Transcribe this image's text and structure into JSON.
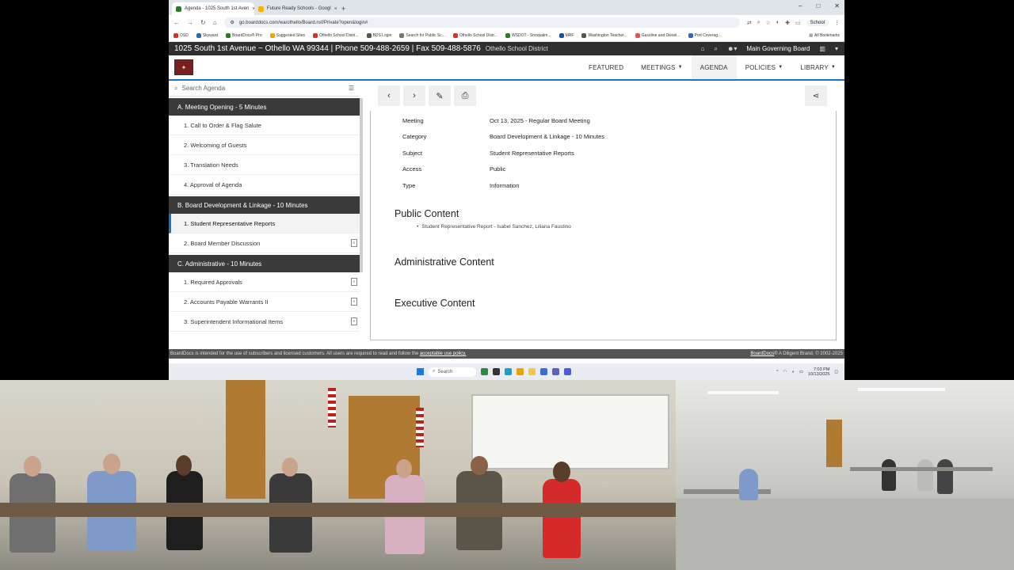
{
  "browser": {
    "tabs": [
      {
        "label": "Agenda - 1025 South 1st Aven",
        "color": "#2a7a2a",
        "active": true
      },
      {
        "label": "Future Ready Schools - Googl",
        "color": "#f4b400",
        "active": false
      }
    ],
    "url": "go.boarddocs.com/wa/othello/Board.nsf/Private?open&login#",
    "profile_label": "School",
    "bookmarks": [
      "OSD",
      "Skyward",
      "BoardDocs® Pro",
      "Suggested Sites",
      "Othello School Distri...",
      "BDS Login",
      "Search for Public Sc...",
      "Othello School Distr...",
      "WSDOT - Snoqualm...",
      "MRF",
      "Washington Teacher...",
      "Gasoline and Diesel...",
      "Port Coverag..."
    ],
    "all_bookmarks": "All Bookmarks"
  },
  "site": {
    "contact": "1025 South 1st Avenue ~ Othello WA 99344 | Phone 509-488-2659 | Fax 509-488-5876",
    "district": "Othello School District",
    "board_name": "Main Governing Board",
    "nav": [
      "FEATURED",
      "MEETINGS",
      "AGENDA",
      "POLICIES",
      "LIBRARY"
    ]
  },
  "sidebar": {
    "search_placeholder": "Search Agenda",
    "sections": [
      {
        "title": "A. Meeting Opening - 5 Minutes",
        "items": [
          {
            "label": "1. Call to Order & Flag Salute",
            "doc": false,
            "active": false
          },
          {
            "label": "2. Welcoming of Guests",
            "doc": false,
            "active": false
          },
          {
            "label": "3. Translation Needs",
            "doc": false,
            "active": false
          },
          {
            "label": "4. Approval of Agenda",
            "doc": false,
            "active": false
          }
        ]
      },
      {
        "title": "B. Board Development & Linkage - 10 Minutes",
        "items": [
          {
            "label": "1. Student Representative Reports",
            "doc": false,
            "active": true
          },
          {
            "label": "2. Board Member Discussion",
            "doc": true,
            "active": false
          }
        ]
      },
      {
        "title": "C. Administrative - 10 Minutes",
        "items": [
          {
            "label": "1. Required Approvals",
            "doc": true,
            "active": false
          },
          {
            "label": "2. Accounts Payable Warrants II",
            "doc": true,
            "active": false
          },
          {
            "label": "3. Superintendent Informational Items",
            "doc": true,
            "active": false
          }
        ]
      }
    ]
  },
  "detail": {
    "rows": [
      {
        "key": "Meeting",
        "value": "Oct 13, 2025 - Regular Board Meeting"
      },
      {
        "key": "Category",
        "value": "Board Development & Linkage - 10 Minutes"
      },
      {
        "key": "Subject",
        "value": "Student Representative Reports"
      },
      {
        "key": "Access",
        "value": "Public"
      },
      {
        "key": "Type",
        "value": "Information"
      }
    ],
    "public_heading": "Public Content",
    "public_bullet": "Student Representative Report - Isabel Sanchez, Liliana Faustino",
    "admin_heading": "Administrative Content",
    "exec_heading": "Executive Content"
  },
  "footer": {
    "left_prefix": "BoardDocs is intended for the use of subscribers and licensed customers. All users are required to read and follow the",
    "link": "acceptable use policy.",
    "right_link": "BoardDocs",
    "right_text": "® A Diligent Brand, © 2002-2025"
  },
  "taskbar": {
    "search": "Search",
    "time": "7:03 PM",
    "date": "10/13/2025"
  }
}
